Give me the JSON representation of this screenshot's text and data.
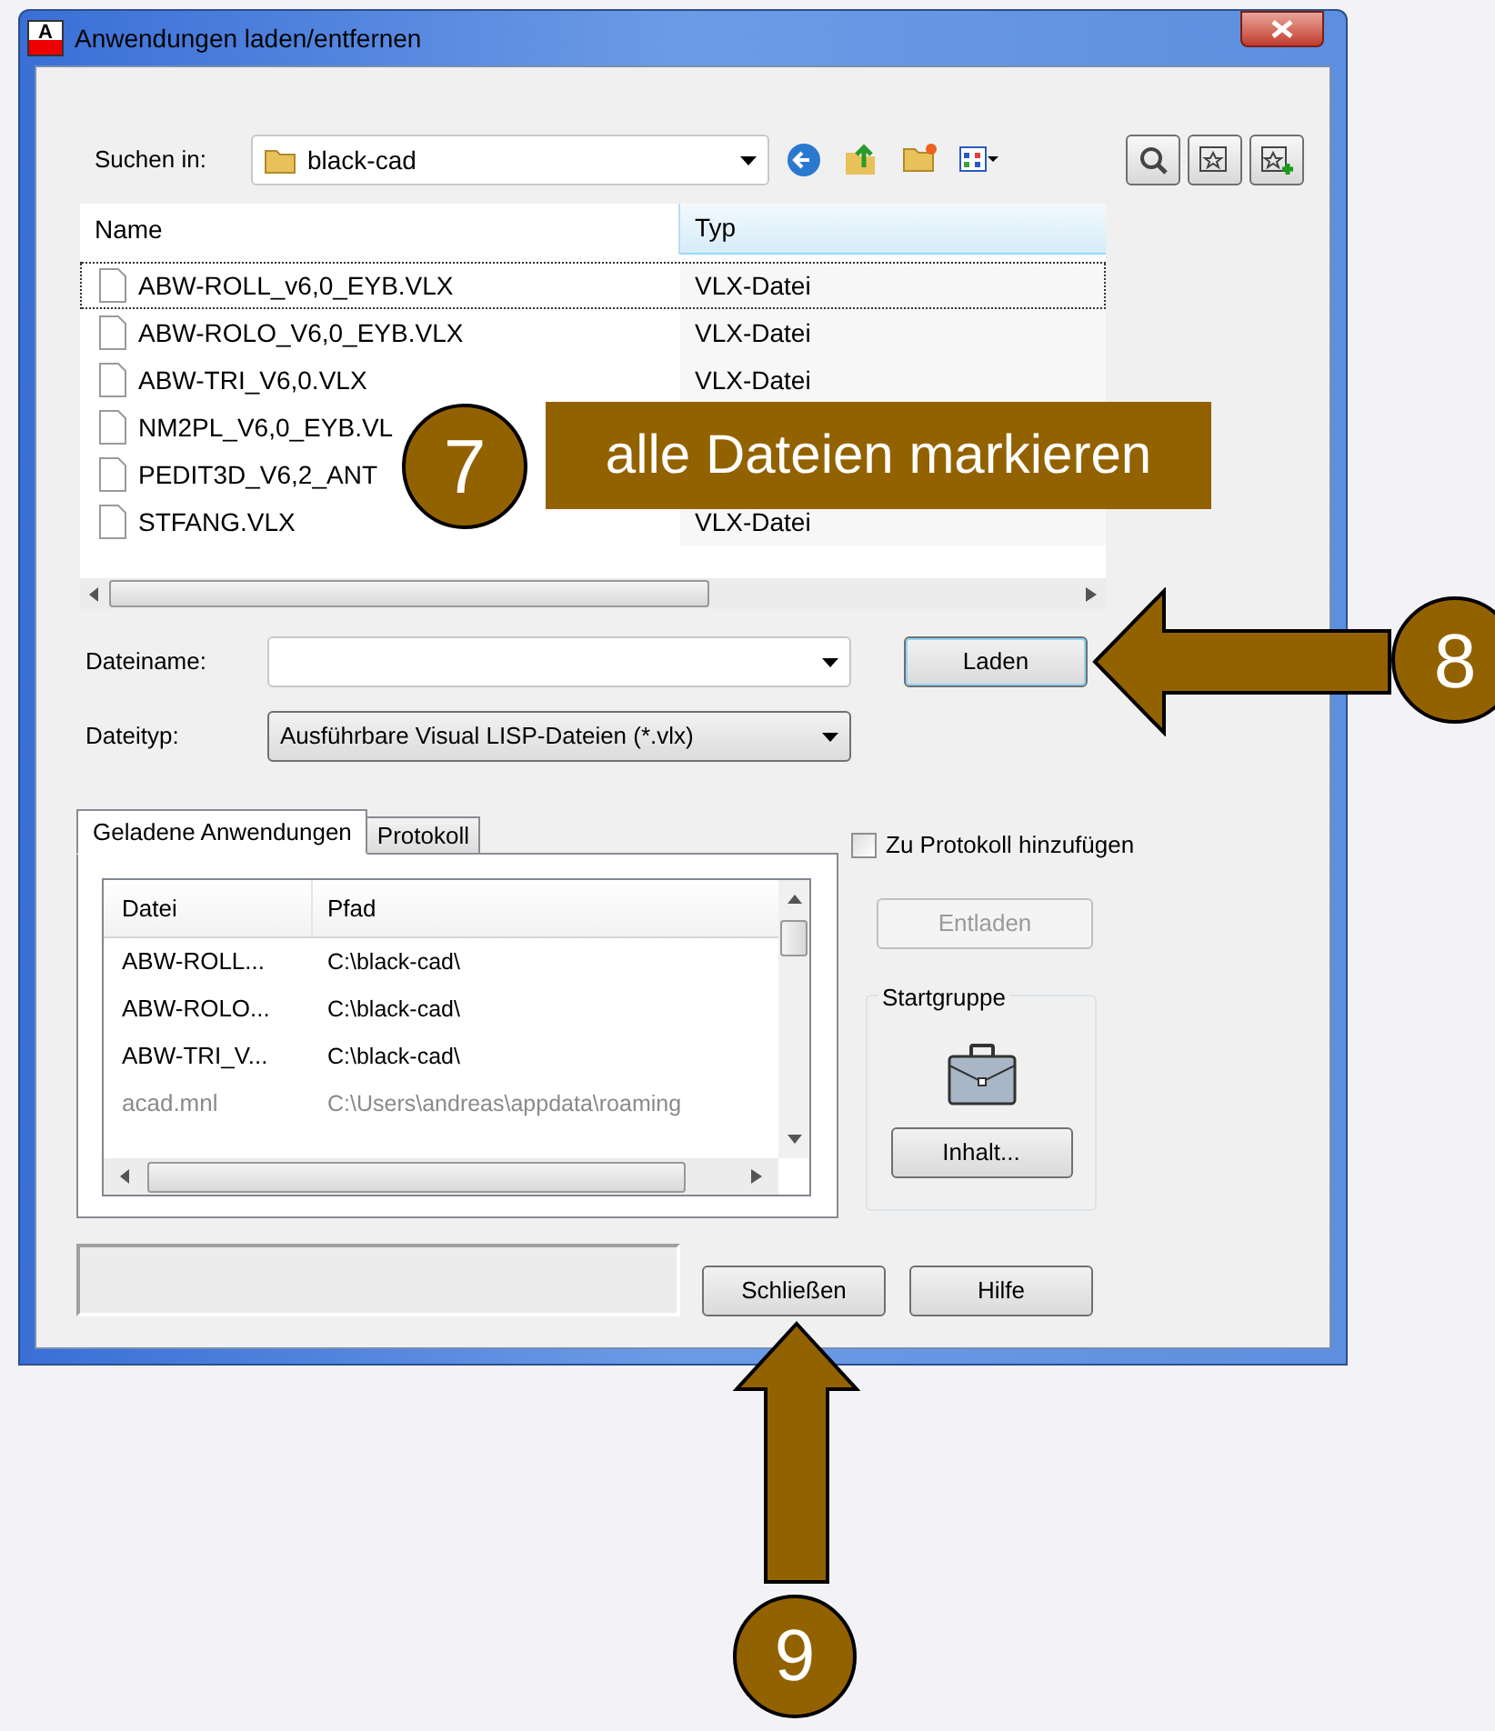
{
  "window": {
    "title": "Anwendungen laden/entfernen",
    "logo_text": "A"
  },
  "look_in": {
    "label": "Suchen in:",
    "value": "black-cad"
  },
  "file_list": {
    "columns": [
      "Name",
      "Typ"
    ],
    "rows": [
      {
        "name": "ABW-ROLL_v6,0_EYB.VLX",
        "type": "VLX-Datei",
        "focused": true
      },
      {
        "name": "ABW-ROLO_V6,0_EYB.VLX",
        "type": "VLX-Datei",
        "focused": false
      },
      {
        "name": "ABW-TRI_V6,0.VLX",
        "type": "VLX-Datei",
        "focused": false
      },
      {
        "name": "NM2PL_V6,0_EYB.VL",
        "focused": false
      },
      {
        "name": "PEDIT3D_V6,2_ANT",
        "focused": false
      },
      {
        "name": "STFANG.VLX",
        "type": "VLX-Datei",
        "focused": false
      }
    ]
  },
  "file_name": {
    "label": "Dateiname:"
  },
  "file_type": {
    "label": "Dateityp:",
    "value": "Ausführbare Visual LISP-Dateien (*.vlx)"
  },
  "load_button": "Laden",
  "tabs": [
    {
      "label": "Geladene Anwendungen",
      "selected": true
    },
    {
      "label": "Protokoll",
      "selected": false
    }
  ],
  "loaded_apps": {
    "columns": [
      "Datei",
      "Pfad"
    ],
    "rows": [
      {
        "file": "ABW-ROLL...",
        "path": "C:\\black-cad\\",
        "dimmed": false
      },
      {
        "file": "ABW-ROLO...",
        "path": "C:\\black-cad\\",
        "dimmed": false
      },
      {
        "file": "ABW-TRI_V...",
        "path": "C:\\black-cad\\",
        "dimmed": false
      },
      {
        "file": "acad.mnl",
        "path": "C:\\Users\\andreas\\appdata\\roaming",
        "dimmed": true
      }
    ]
  },
  "add_to_history": {
    "label": "Zu Protokoll hinzufügen",
    "checked": false
  },
  "unload_button": {
    "label": "Entladen",
    "disabled": true
  },
  "startup_group": {
    "title": "Startgruppe",
    "button": "Inhalt..."
  },
  "buttons": [
    "Schließen",
    "Hilfe"
  ],
  "annotations": [
    {
      "kind": "step",
      "number": "7",
      "text": "alle Dateien markieren"
    },
    {
      "kind": "arrow-left",
      "number": "8"
    },
    {
      "kind": "arrow-up",
      "number": "9"
    }
  ]
}
